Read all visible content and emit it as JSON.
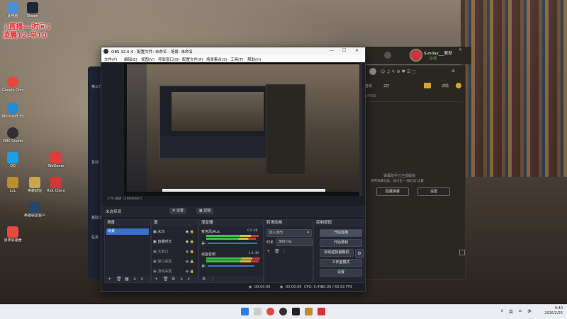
{
  "desktop": {
    "broadcast_note_line1": "↓直播---时间↓",
    "broadcast_note_line2": "凌晨12-早10",
    "icons": [
      {
        "label": "此电脑",
        "color": "#4a90d9"
      },
      {
        "label": "Steam",
        "color": "#1b2838"
      },
      {
        "label": "Google Chrome",
        "color": "#e8453c"
      },
      {
        "label": "Microsoft Edge",
        "color": "#1f8ad6"
      },
      {
        "label": "OBS Studio",
        "color": "#302e31"
      },
      {
        "label": "QQ",
        "color": "#1aa0e8"
      },
      {
        "label": "LoL",
        "color": "#b8902e"
      },
      {
        "label": "英雄联盟",
        "color": "#c9a64a"
      },
      {
        "label": "雷神加速器",
        "color": "#e84b3c"
      },
      {
        "label": "WeGame",
        "color": "#e23b3b"
      },
      {
        "label": "英雄联盟客户端",
        "color": "#27466b"
      },
      {
        "label": "Riot Client",
        "color": "#d13639"
      }
    ]
  },
  "bg_left_app": {
    "items": [
      "第三方",
      "互动",
      "基础工",
      "任务"
    ]
  },
  "kugou": {
    "tabs": [
      "音乐",
      "2万"
    ],
    "user_name": "Sunday___默然",
    "user_status": "在线",
    "detail_btn": "详情",
    "empty_line1": "弹幕助手已全部解锁",
    "empty_line2": "使用弹幕功能，请点击 一键启动 设置",
    "btn_hide": "隐藏弹幕",
    "btn_settings": "设置",
    "count": "14005"
  },
  "obs": {
    "title": "OBS 32.0.4 - 配置文件: 未命名 - 场景: 未命名",
    "menus": [
      "文件(F)",
      "编辑(E)",
      "视图(V)",
      "停靠窗口(D)",
      "配置文件(P)",
      "场景集合(S)",
      "工具(T)",
      "帮助(H)"
    ],
    "preview_status": "27%  缩放（1064x607）",
    "no_source": "未选择源",
    "properties_btn": "设置",
    "filters_btn": "滤镜",
    "docks": {
      "scenes": "场景",
      "sources": "源",
      "mixer": "混音器",
      "transitions": "转场动画",
      "controls": "控制按钮"
    },
    "scene_item": "场景",
    "sources": [
      "水印",
      "直播时长",
      "大窗口",
      "窗口采集",
      "游戏采集"
    ],
    "mixer": [
      {
        "name": "麦克风/Aux",
        "db": "0.0 dB"
      },
      {
        "name": "桌面音频",
        "db": "-1.4 dB"
      }
    ],
    "transition_select": "淡入淡出",
    "duration_label": "时长",
    "duration_value": "300 ms",
    "controls": [
      "开始直播",
      "开始录制",
      "启动虚拟摄像机",
      "工作室模式",
      "设置"
    ],
    "status": {
      "stream_time": "00:00:00",
      "rec_time": "00:00:00",
      "cpu": "CPU: 0.4%",
      "fps": "60.00 / 60.00 FPS"
    }
  },
  "taskbar": {
    "lang": "英",
    "time": "0:40",
    "date": "2026/2/25"
  }
}
